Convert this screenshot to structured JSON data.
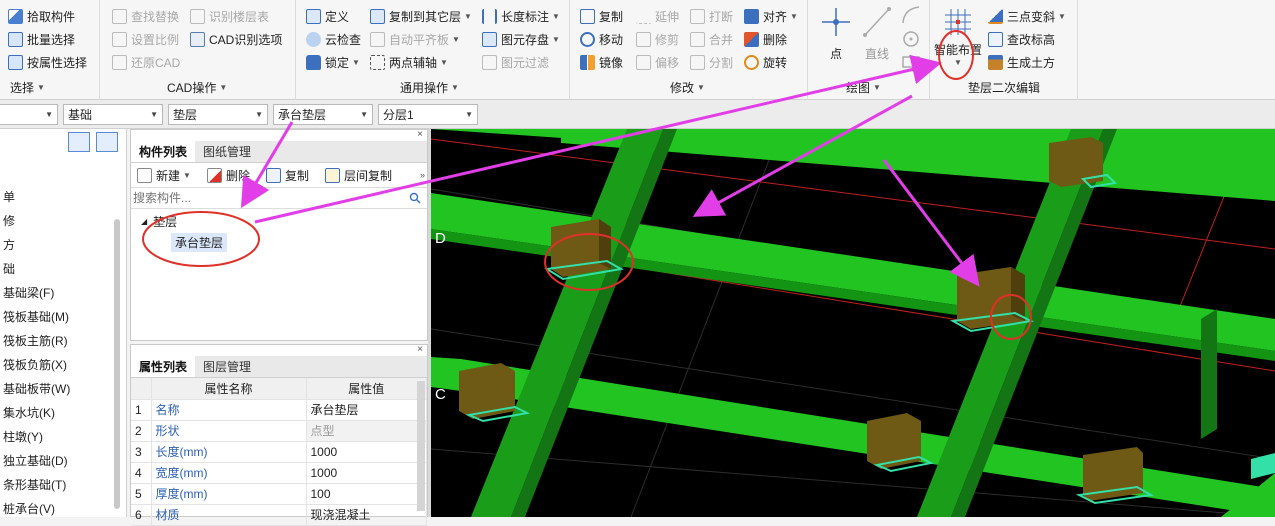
{
  "ribbon": {
    "select_group": {
      "label": "选择",
      "items": [
        "拾取构件",
        "批量选择",
        "按属性选择"
      ]
    },
    "cad_group": {
      "label": "CAD操作",
      "items": [
        "查找替换",
        "识别楼层表",
        "设置比例",
        "CAD识别选项",
        "还原CAD"
      ]
    },
    "general_group": {
      "label": "通用操作",
      "items": [
        "定义",
        "复制到其它层",
        "长度标注",
        "云检查",
        "自动平齐板",
        "图元存盘",
        "锁定",
        "两点辅轴",
        "图元过滤"
      ]
    },
    "modify_group": {
      "label": "修改",
      "items": [
        "复制",
        "延伸",
        "打断",
        "对齐",
        "移动",
        "修剪",
        "合并",
        "删除",
        "镜像",
        "偏移",
        "分割",
        "旋转"
      ]
    },
    "draw_group": {
      "label": "绘图",
      "items": [
        "点",
        "直线"
      ]
    },
    "cushion_group": {
      "label": "垫层二次编辑",
      "smart_place": "智能布置",
      "items": [
        "三点变斜",
        "查改标高",
        "生成土方"
      ]
    }
  },
  "filterbar": {
    "combo1": "",
    "combo2": "基础",
    "combo3": "垫层",
    "combo4": "承台垫层",
    "combo5": "分层1"
  },
  "leftnav": {
    "partial": [
      "单",
      "修",
      "方",
      "础"
    ],
    "items": [
      "基础梁(F)",
      "筏板基础(M)",
      "筏板主筋(R)",
      "筏板负筋(X)",
      "基础板带(W)",
      "集水坑(K)",
      "柱墩(Y)",
      "独立基础(D)",
      "条形基础(T)",
      "桩承台(V)"
    ]
  },
  "component_panel": {
    "tabs": [
      "构件列表",
      "图纸管理"
    ],
    "tools": [
      "新建",
      "删除",
      "复制",
      "层间复制"
    ],
    "search_placeholder": "搜索构件...",
    "tree_parent": "垫层",
    "tree_child": "承台垫层"
  },
  "property_panel": {
    "tabs": [
      "属性列表",
      "图层管理"
    ],
    "headers": [
      "属性名称",
      "属性值"
    ],
    "rows": [
      {
        "no": "1",
        "name": "名称",
        "value": "承台垫层"
      },
      {
        "no": "2",
        "name": "形状",
        "value": "点型"
      },
      {
        "no": "3",
        "name": "长度(mm)",
        "value": "1000"
      },
      {
        "no": "4",
        "name": "宽度(mm)",
        "value": "1000"
      },
      {
        "no": "5",
        "name": "厚度(mm)",
        "value": "100"
      },
      {
        "no": "6",
        "name": "材质",
        "value": "现浇混凝土"
      }
    ]
  },
  "viewport": {
    "axis_d": "D",
    "axis_c": "C"
  },
  "colors": {
    "beam": "#22c422",
    "beam_side": "#138a13",
    "cap": "#6e5a14",
    "cushion": "#33e0a8",
    "annotation_circle": "#e0302a",
    "annotation_arrow": "#e23ee8"
  }
}
